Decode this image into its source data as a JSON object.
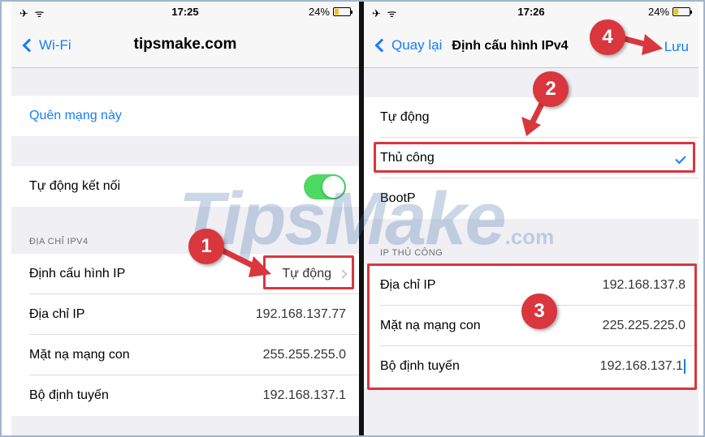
{
  "left": {
    "status": {
      "time": "17:25",
      "battery": "24%",
      "signal": "✈ ᯤ"
    },
    "nav": {
      "back": "Wi-Fi",
      "title": "tipsmake.com"
    },
    "forget": "Quên mạng này",
    "auto_join": {
      "label": "Tự động kết nối",
      "on": true
    },
    "section": "ĐỊA CHỈ IPV4",
    "config_ip": {
      "label": "Định cấu hình IP",
      "value": "Tự động"
    },
    "ip": {
      "label": "Địa chỉ IP",
      "value": "192.168.137.77"
    },
    "subnet": {
      "label": "Mặt nạ mạng con",
      "value": "255.255.255.0"
    },
    "router": {
      "label": "Bộ định tuyến",
      "value": "192.168.137.1"
    }
  },
  "right": {
    "status": {
      "time": "17:26",
      "battery": "24%",
      "signal": "✈ ᯤ"
    },
    "nav": {
      "back": "Quay lại",
      "title": "Định cấu hình IPv4",
      "save": "Lưu"
    },
    "options": {
      "auto": "Tự động",
      "manual": "Thủ công",
      "bootp": "BootP"
    },
    "section": "IP THỦ CÔNG",
    "ip": {
      "label": "Địa chỉ IP",
      "value": "192.168.137.8"
    },
    "subnet": {
      "label": "Mặt nạ mạng con",
      "value": "225.225.225.0"
    },
    "router": {
      "label": "Bộ định tuyến",
      "value": "192.168.137.1"
    }
  },
  "annotations": {
    "step1": "1",
    "step2": "2",
    "step3": "3",
    "step4": "4"
  },
  "watermark": {
    "main": "TipsMake",
    "suffix": ".com"
  },
  "colors": {
    "accent": "#147efb",
    "toggle_on": "#4cd964",
    "annotation": "#d9363e"
  }
}
